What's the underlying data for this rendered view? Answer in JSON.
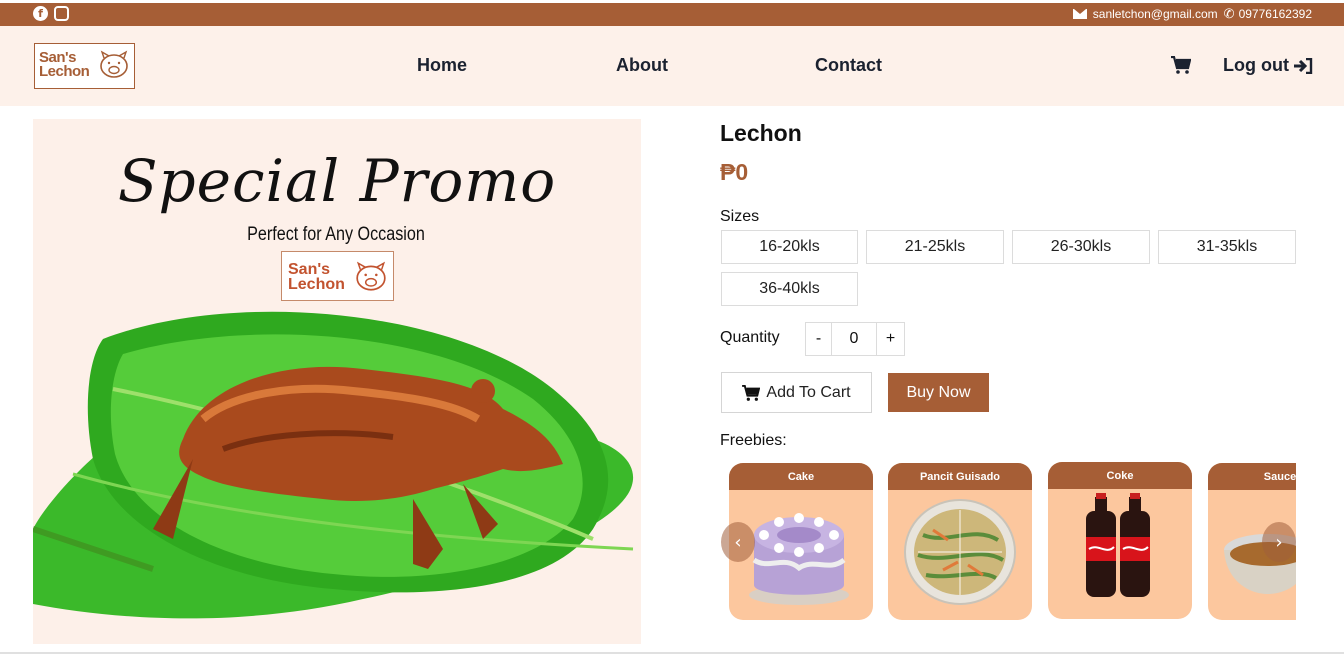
{
  "topbar": {
    "icons": [
      "facebook-icon",
      "instagram-icon",
      "envelope-icon",
      "phone-icon"
    ],
    "email": "sanletchon@gmail.com",
    "phone": "09776162392"
  },
  "nav": {
    "logo_text_1": "San's",
    "logo_text_2": "Lechon",
    "links": [
      "Home",
      "About",
      "Contact"
    ],
    "logout": "Log out",
    "icons": [
      "cart-icon",
      "sign-out-icon"
    ]
  },
  "promo": {
    "title": "Special Promo",
    "subtitle": "Perfect for Any Occasion",
    "logo_text_1": "San's",
    "logo_text_2": "Lechon"
  },
  "product": {
    "name": "Lechon",
    "price": "₱0",
    "sizes_label": "Sizes",
    "sizes": [
      "16-20kls",
      "21-25kls",
      "26-30kls",
      "31-35kls",
      "36-40kls"
    ],
    "quantity_label": "Quantity",
    "quantity_minus": "-",
    "quantity_value": "0",
    "quantity_plus": "+",
    "add_to_cart": "Add To Cart",
    "buy_now": "Buy Now",
    "freebies_label": "Freebies:",
    "freebies": [
      "Cake",
      "Pancit Guisado",
      "Coke",
      "Sauce"
    ]
  },
  "colors": {
    "brand": "#a65e36",
    "nav_bg": "#fdf1ea",
    "card_bg": "#fcc79e"
  }
}
